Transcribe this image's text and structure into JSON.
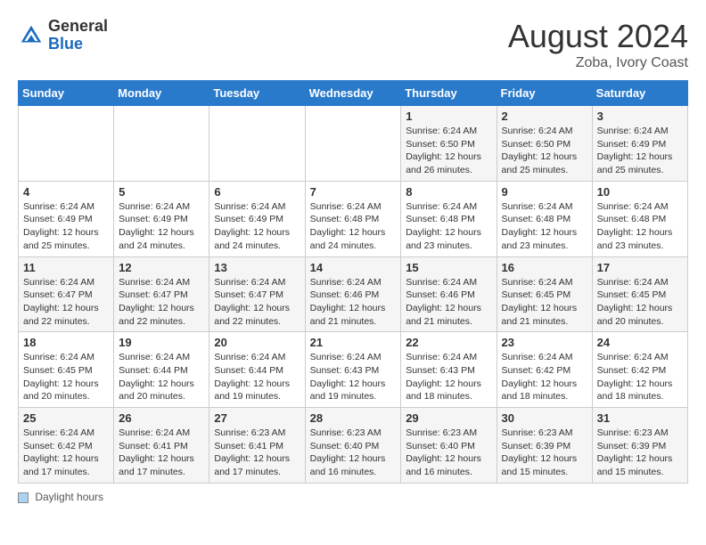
{
  "header": {
    "logo_general": "General",
    "logo_blue": "Blue",
    "month_year": "August 2024",
    "location": "Zoba, Ivory Coast"
  },
  "footer": {
    "daylight_label": "Daylight hours"
  },
  "calendar": {
    "days_of_week": [
      "Sunday",
      "Monday",
      "Tuesday",
      "Wednesday",
      "Thursday",
      "Friday",
      "Saturday"
    ],
    "weeks": [
      [
        {
          "day": "",
          "info": ""
        },
        {
          "day": "",
          "info": ""
        },
        {
          "day": "",
          "info": ""
        },
        {
          "day": "",
          "info": ""
        },
        {
          "day": "1",
          "info": "Sunrise: 6:24 AM\nSunset: 6:50 PM\nDaylight: 12 hours\nand 26 minutes."
        },
        {
          "day": "2",
          "info": "Sunrise: 6:24 AM\nSunset: 6:50 PM\nDaylight: 12 hours\nand 25 minutes."
        },
        {
          "day": "3",
          "info": "Sunrise: 6:24 AM\nSunset: 6:49 PM\nDaylight: 12 hours\nand 25 minutes."
        }
      ],
      [
        {
          "day": "4",
          "info": "Sunrise: 6:24 AM\nSunset: 6:49 PM\nDaylight: 12 hours\nand 25 minutes."
        },
        {
          "day": "5",
          "info": "Sunrise: 6:24 AM\nSunset: 6:49 PM\nDaylight: 12 hours\nand 24 minutes."
        },
        {
          "day": "6",
          "info": "Sunrise: 6:24 AM\nSunset: 6:49 PM\nDaylight: 12 hours\nand 24 minutes."
        },
        {
          "day": "7",
          "info": "Sunrise: 6:24 AM\nSunset: 6:48 PM\nDaylight: 12 hours\nand 24 minutes."
        },
        {
          "day": "8",
          "info": "Sunrise: 6:24 AM\nSunset: 6:48 PM\nDaylight: 12 hours\nand 23 minutes."
        },
        {
          "day": "9",
          "info": "Sunrise: 6:24 AM\nSunset: 6:48 PM\nDaylight: 12 hours\nand 23 minutes."
        },
        {
          "day": "10",
          "info": "Sunrise: 6:24 AM\nSunset: 6:48 PM\nDaylight: 12 hours\nand 23 minutes."
        }
      ],
      [
        {
          "day": "11",
          "info": "Sunrise: 6:24 AM\nSunset: 6:47 PM\nDaylight: 12 hours\nand 22 minutes."
        },
        {
          "day": "12",
          "info": "Sunrise: 6:24 AM\nSunset: 6:47 PM\nDaylight: 12 hours\nand 22 minutes."
        },
        {
          "day": "13",
          "info": "Sunrise: 6:24 AM\nSunset: 6:47 PM\nDaylight: 12 hours\nand 22 minutes."
        },
        {
          "day": "14",
          "info": "Sunrise: 6:24 AM\nSunset: 6:46 PM\nDaylight: 12 hours\nand 21 minutes."
        },
        {
          "day": "15",
          "info": "Sunrise: 6:24 AM\nSunset: 6:46 PM\nDaylight: 12 hours\nand 21 minutes."
        },
        {
          "day": "16",
          "info": "Sunrise: 6:24 AM\nSunset: 6:45 PM\nDaylight: 12 hours\nand 21 minutes."
        },
        {
          "day": "17",
          "info": "Sunrise: 6:24 AM\nSunset: 6:45 PM\nDaylight: 12 hours\nand 20 minutes."
        }
      ],
      [
        {
          "day": "18",
          "info": "Sunrise: 6:24 AM\nSunset: 6:45 PM\nDaylight: 12 hours\nand 20 minutes."
        },
        {
          "day": "19",
          "info": "Sunrise: 6:24 AM\nSunset: 6:44 PM\nDaylight: 12 hours\nand 20 minutes."
        },
        {
          "day": "20",
          "info": "Sunrise: 6:24 AM\nSunset: 6:44 PM\nDaylight: 12 hours\nand 19 minutes."
        },
        {
          "day": "21",
          "info": "Sunrise: 6:24 AM\nSunset: 6:43 PM\nDaylight: 12 hours\nand 19 minutes."
        },
        {
          "day": "22",
          "info": "Sunrise: 6:24 AM\nSunset: 6:43 PM\nDaylight: 12 hours\nand 18 minutes."
        },
        {
          "day": "23",
          "info": "Sunrise: 6:24 AM\nSunset: 6:42 PM\nDaylight: 12 hours\nand 18 minutes."
        },
        {
          "day": "24",
          "info": "Sunrise: 6:24 AM\nSunset: 6:42 PM\nDaylight: 12 hours\nand 18 minutes."
        }
      ],
      [
        {
          "day": "25",
          "info": "Sunrise: 6:24 AM\nSunset: 6:42 PM\nDaylight: 12 hours\nand 17 minutes."
        },
        {
          "day": "26",
          "info": "Sunrise: 6:24 AM\nSunset: 6:41 PM\nDaylight: 12 hours\nand 17 minutes."
        },
        {
          "day": "27",
          "info": "Sunrise: 6:23 AM\nSunset: 6:41 PM\nDaylight: 12 hours\nand 17 minutes."
        },
        {
          "day": "28",
          "info": "Sunrise: 6:23 AM\nSunset: 6:40 PM\nDaylight: 12 hours\nand 16 minutes."
        },
        {
          "day": "29",
          "info": "Sunrise: 6:23 AM\nSunset: 6:40 PM\nDaylight: 12 hours\nand 16 minutes."
        },
        {
          "day": "30",
          "info": "Sunrise: 6:23 AM\nSunset: 6:39 PM\nDaylight: 12 hours\nand 15 minutes."
        },
        {
          "day": "31",
          "info": "Sunrise: 6:23 AM\nSunset: 6:39 PM\nDaylight: 12 hours\nand 15 minutes."
        }
      ]
    ]
  }
}
